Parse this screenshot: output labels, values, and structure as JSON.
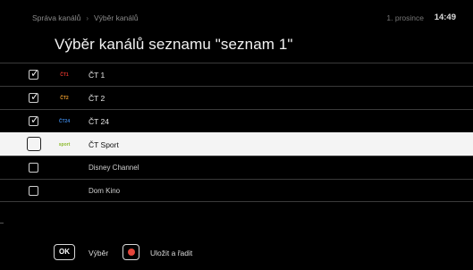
{
  "header": {
    "breadcrumb": [
      "Správa kanálů",
      "Výběr kanálů"
    ],
    "separator": "›",
    "date": "1. prosince",
    "time": "14:49"
  },
  "page_title": "Výběr kanálů seznamu \"seznam 1\"",
  "channels": [
    {
      "name": "ČT 1",
      "checked": true,
      "logo": "ČT1",
      "logo_color": "#d8332a",
      "focused": false
    },
    {
      "name": "ČT 2",
      "checked": true,
      "logo": "ČT2",
      "logo_color": "#e89a2c",
      "focused": false
    },
    {
      "name": "ČT 24",
      "checked": true,
      "logo": "ČT24",
      "logo_color": "#3a7fd5",
      "focused": false
    },
    {
      "name": "ČT Sport",
      "checked": false,
      "logo": "sport",
      "logo_color": "#8dbb2f",
      "focused": true
    },
    {
      "name": "Disney Channel",
      "checked": false,
      "logo": "",
      "logo_color": "",
      "focused": false
    },
    {
      "name": "Dom Kino",
      "checked": false,
      "logo": "",
      "logo_color": "",
      "focused": false
    }
  ],
  "check_glyph": "✓",
  "footer": {
    "ok_key": "OK",
    "ok_label": "Výběr",
    "record_label": "Uložit a řadit",
    "record_color": "#e4463b"
  }
}
